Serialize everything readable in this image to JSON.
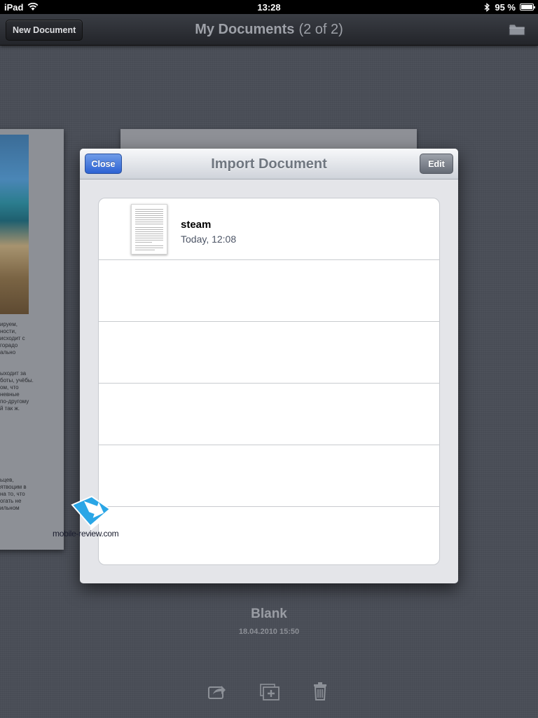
{
  "status_bar": {
    "device": "iPad",
    "time": "13:28",
    "battery": "95 %"
  },
  "nav": {
    "new_document_label": "New Document",
    "title": "My Documents",
    "count": "(2 of 2)"
  },
  "background_doc": {
    "text_lines": [
      "ируем,",
      "ности,",
      "исходит с",
      "горадо",
      "ально",
      "ыходит за",
      "боты, учёбы.",
      "ом, что",
      "невные",
      "по-другому",
      "й так ж.",
      "ьцев,",
      "ятвоцим в",
      "на то, что",
      "огать не",
      "ильном"
    ]
  },
  "popover": {
    "title": "Import Document",
    "close_label": "Close",
    "edit_label": "Edit",
    "documents": [
      {
        "name": "steam",
        "date": "Today, 12:08"
      }
    ]
  },
  "watermark": {
    "text": "mobile-review.com"
  },
  "current_doc": {
    "name": "Blank",
    "date": "18.04.2010 15:50"
  },
  "colors": {
    "accent_blue": "#2d63d3",
    "background": "#4a4e57"
  }
}
